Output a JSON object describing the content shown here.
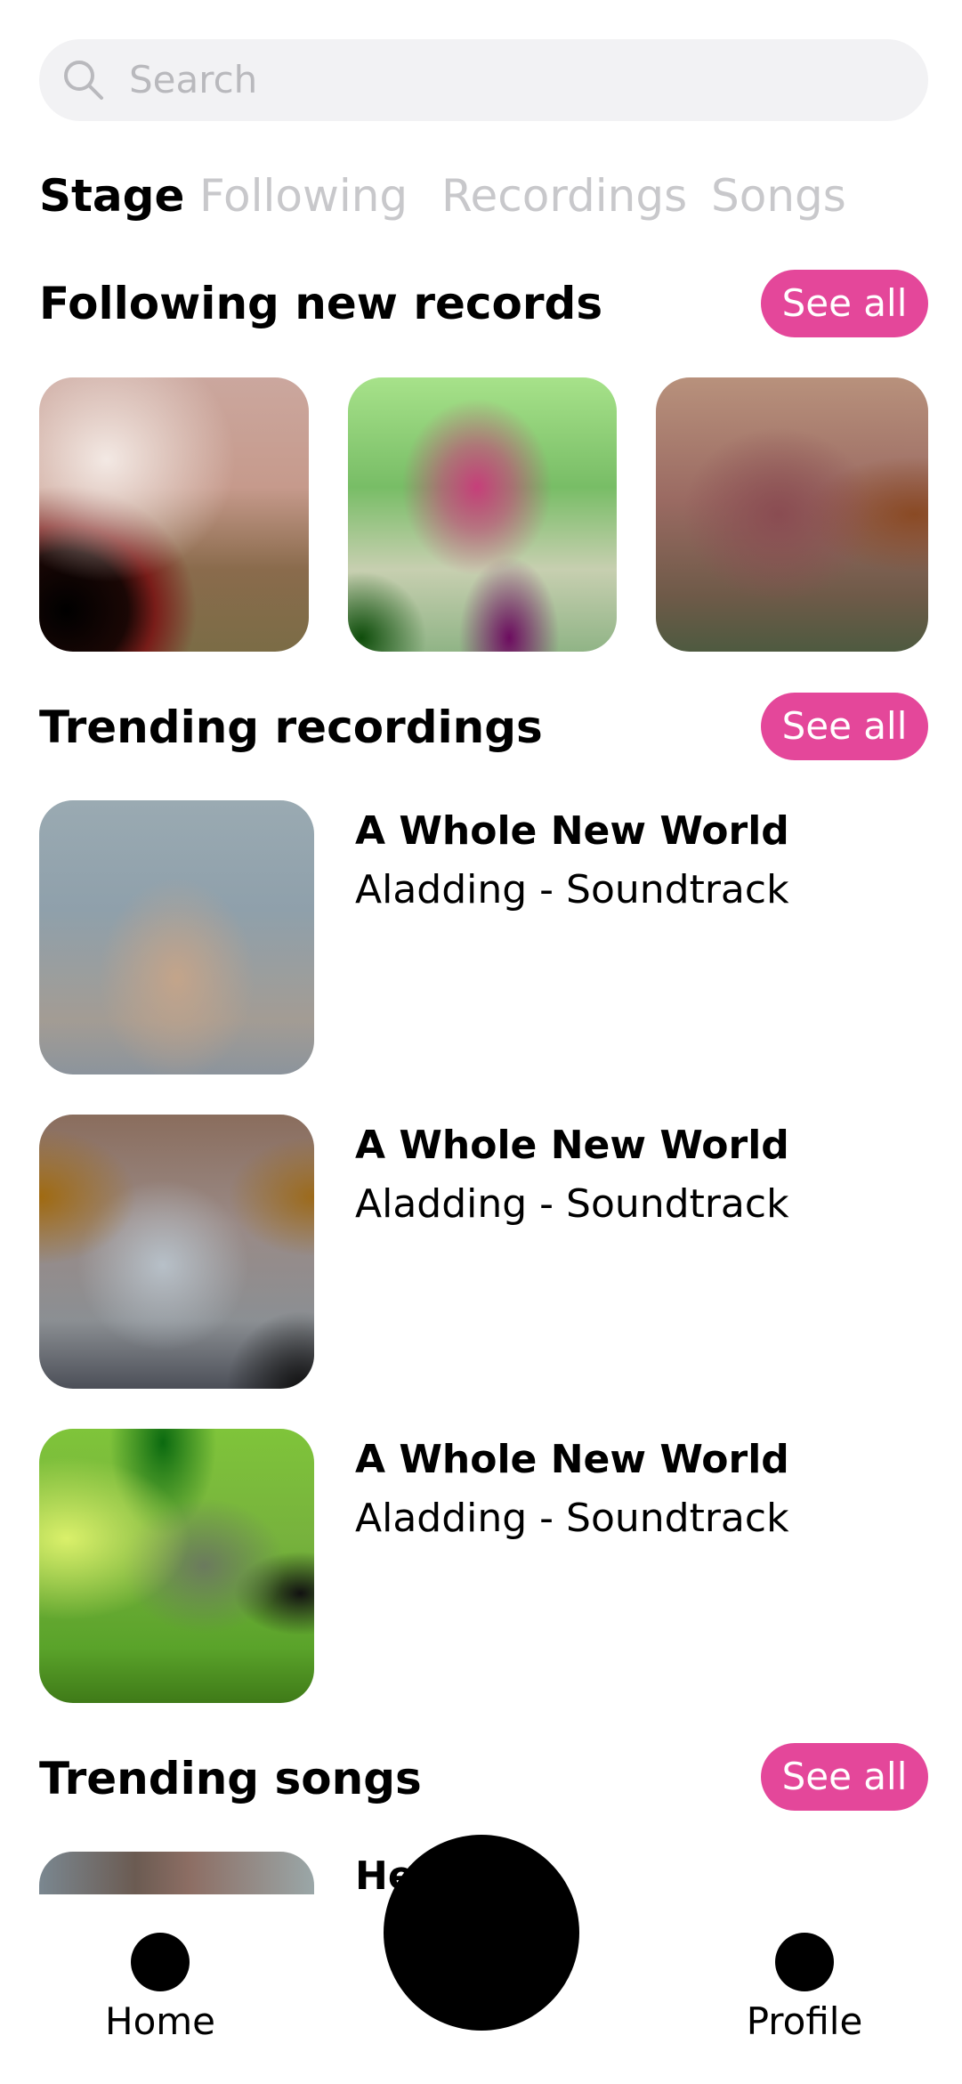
{
  "search": {
    "placeholder": "Search",
    "icon": "search-icon"
  },
  "tabs": [
    {
      "label": "Stage",
      "active": true
    },
    {
      "label": "Following",
      "active": false
    },
    {
      "label": "Recordings",
      "active": false
    },
    {
      "label": "Songs",
      "active": false
    }
  ],
  "sections": {
    "following": {
      "title": "Following new records",
      "see_all": "See all"
    },
    "trending_recordings": {
      "title": "Trending recordings",
      "see_all": "See all"
    },
    "trending_songs": {
      "title": "Trending songs",
      "see_all": "See all"
    }
  },
  "trending_recordings": [
    {
      "title": "A Whole New World",
      "subtitle": "Aladding - Soundtrack"
    },
    {
      "title": "A Whole New World",
      "subtitle": "Aladding - Soundtrack"
    },
    {
      "title": "A Whole New World",
      "subtitle": "Aladding - Soundtrack"
    }
  ],
  "trending_songs": [
    {
      "title_partial": "He"
    }
  ],
  "bottom_nav": {
    "home": "Home",
    "profile": "Profile"
  },
  "colors": {
    "accent": "#e4479a",
    "search_bg": "#f2f2f4",
    "tab_inactive": "#c8c8cb"
  }
}
